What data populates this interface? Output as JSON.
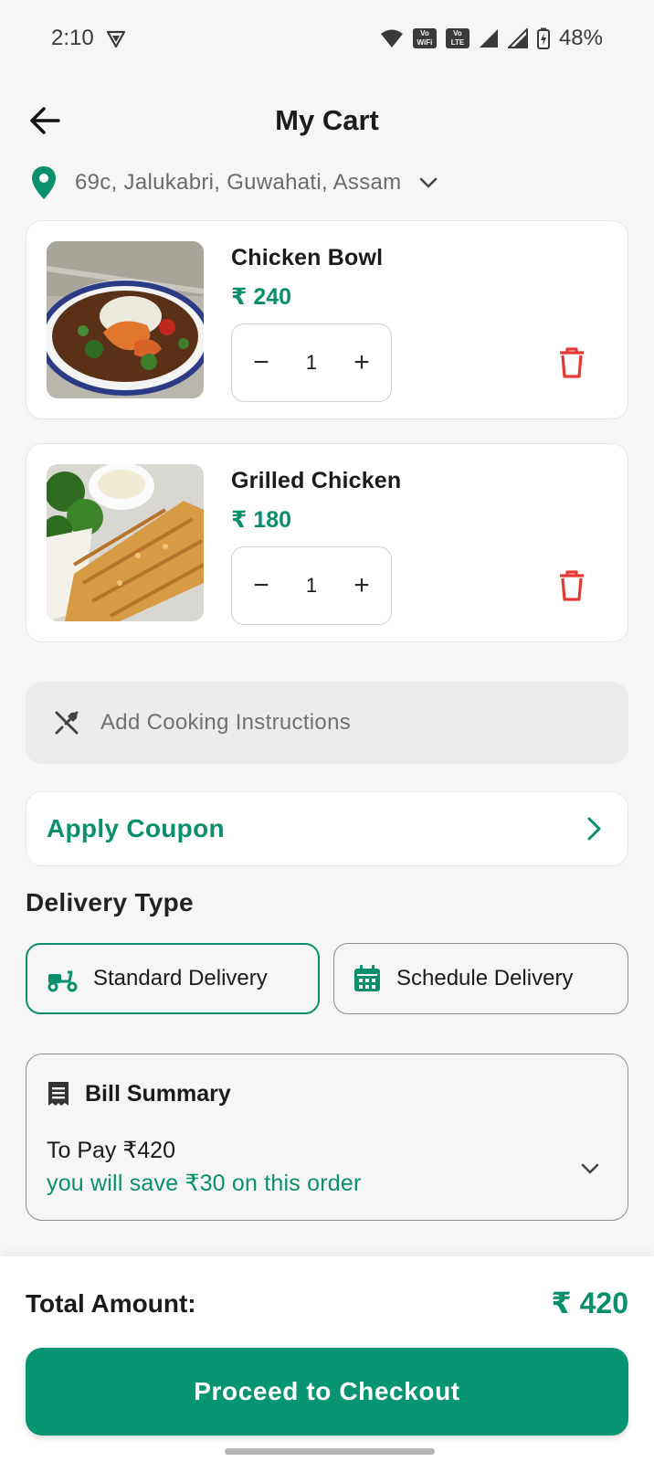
{
  "status_bar": {
    "time": "2:10",
    "battery": "48%",
    "badge_1": "Vo WiFi",
    "badge_2": "Vo LTE"
  },
  "header": {
    "title": "My Cart"
  },
  "address": {
    "text": "69c, Jalukabri, Guwahati, Assam"
  },
  "cart": {
    "items": [
      {
        "name": "Chicken Bowl",
        "price": "₹ 240",
        "quantity": "1"
      },
      {
        "name": "Grilled Chicken",
        "price": "₹ 180",
        "quantity": "1"
      }
    ]
  },
  "instructions": {
    "placeholder": "Add Cooking Instructions"
  },
  "coupon": {
    "label": "Apply Coupon"
  },
  "delivery": {
    "heading": "Delivery Type",
    "options": [
      {
        "label": "Standard Delivery",
        "selected": true
      },
      {
        "label": "Schedule Delivery",
        "selected": false
      }
    ]
  },
  "bill": {
    "title": "Bill Summary",
    "to_pay": "To Pay ₹420",
    "save_note": "you will save ₹30 on this order"
  },
  "footer": {
    "total_label": "Total Amount:",
    "total_value": "₹ 420",
    "checkout_label": "Proceed to Checkout"
  },
  "colors": {
    "accent": "#0a8f6c",
    "danger": "#e53935",
    "background": "#f6f6f6"
  }
}
